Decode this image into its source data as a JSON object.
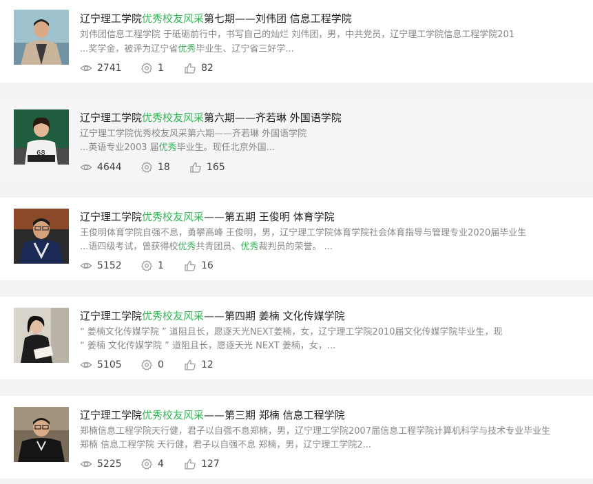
{
  "colors": {
    "highlight": "#34b554",
    "title": "#222222",
    "snippet": "#888888",
    "background": "#f2f3f5"
  },
  "icons": {
    "views": "eye-icon",
    "comments": "gear-icon",
    "likes": "thumbs-up-icon"
  },
  "articles": [
    {
      "title_pre": "辽宁理工学院",
      "title_hl": "优秀校友风采",
      "title_post": "第七期——刘伟团 信息工程学院",
      "line1": "刘伟团信息工程学院 于砥砺前行中，书写自己的灿烂 刘伟团，男，中共党员，辽宁理工学院信息工程学院201",
      "line2_pre": "...奖学金，被评为辽宁省",
      "line2_hl": "优秀",
      "line2_post": "毕业生、辽宁省三好学...",
      "line2_hl2": "",
      "line2_post2": "",
      "views": "2741",
      "comments": "1",
      "likes": "82"
    },
    {
      "title_pre": "辽宁理工学院",
      "title_hl": "优秀校友风采",
      "title_post": "第六期——齐若琳 外国语学院",
      "line1": "辽宁理工学院优秀校友风采第六期——齐若琳 外国语学院",
      "line2_pre": "...英语专业2003 届",
      "line2_hl": "优秀",
      "line2_post": "毕业生。现任北京外国...",
      "line2_hl2": "",
      "line2_post2": "",
      "views": "4644",
      "comments": "18",
      "likes": "165"
    },
    {
      "title_pre": "辽宁理工学院",
      "title_hl": "优秀校友风采",
      "title_post": "——第五期 王俊明 体育学院",
      "line1": "王俊明体育学院自强不息，勇攀高峰   王俊明，男，辽宁理工学院体育学院社会体育指导与管理专业2020届毕业生",
      "line2_pre": "...语四级考试，曾获得校",
      "line2_hl": "优秀",
      "line2_post": "共青团员、",
      "line2_hl2": "优秀",
      "line2_post2": "裁判员的荣誉。 ...",
      "views": "5152",
      "comments": "1",
      "likes": "16"
    },
    {
      "title_pre": "辽宁理工学院",
      "title_hl": "优秀校友风采",
      "title_post": "——第四期 姜楠 文化传媒学院",
      "line1": "“ 姜楠文化传媒学院 ”  道阻且长，愿逐天光NEXT姜楠，女，辽宁理工学院2010届文化传媒学院毕业生，现",
      "line2_pre": "“ 姜楠 文化传媒学院 ” 道阻且长，愿逐天光 NEXT 姜楠，女，...",
      "line2_hl": "",
      "line2_post": "",
      "line2_hl2": "",
      "line2_post2": "",
      "views": "5105",
      "comments": "0",
      "likes": "12"
    },
    {
      "title_pre": "辽宁理工学院",
      "title_hl": "优秀校友风采",
      "title_post": "——第三期 郑楠 信息工程学院",
      "line1": "郑楠信息工程学院天行健，君子以自强不息郑楠，男，辽宁理工学院2007届信息工程学院计算机科学与技术专业毕业生",
      "line2_pre": "郑楠 信息工程学院 天行健，君子以自强不息 郑楠，男，辽宁理工学院2...",
      "line2_hl": "",
      "line2_post": "",
      "line2_hl2": "",
      "line2_post2": "",
      "views": "5225",
      "comments": "4",
      "likes": "127"
    }
  ]
}
